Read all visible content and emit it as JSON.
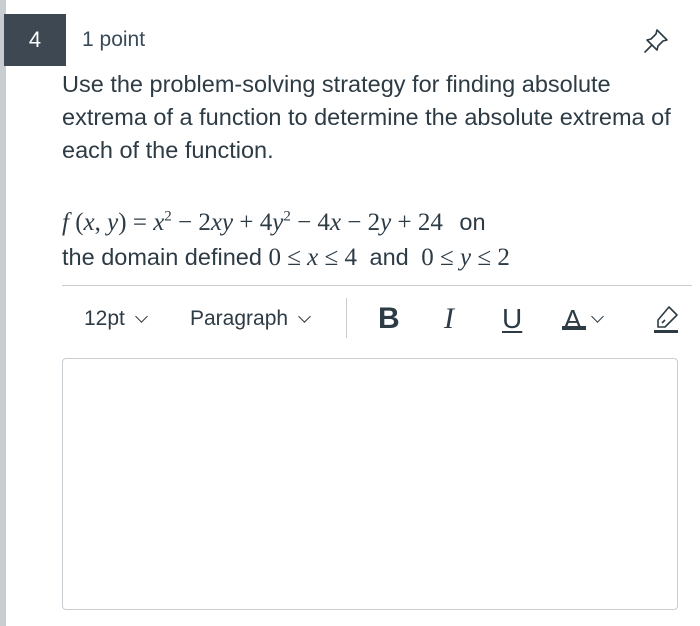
{
  "question": {
    "number": "4",
    "points": "1 point",
    "prompt": "Use the problem-solving strategy for finding absolute extrema of a function to determine the absolute extrema of each of the function.",
    "formula_tail_1": "on",
    "formula_line2_lead": "the domain defined",
    "formula_and": "and",
    "formula_math": "f(x,y) = x² − 2xy + 4y² − 4x − 2y + 24",
    "domain_x": "0 ≤ x ≤ 4",
    "domain_y": "0 ≤ y ≤ 2"
  },
  "toolbar": {
    "font_size": "12pt",
    "block_format": "Paragraph",
    "bold_label": "B",
    "italic_label": "I",
    "underline_label": "U",
    "text_color_label": "A"
  },
  "icons": {
    "pin": "pin-icon",
    "highlight": "highlighter-icon"
  }
}
